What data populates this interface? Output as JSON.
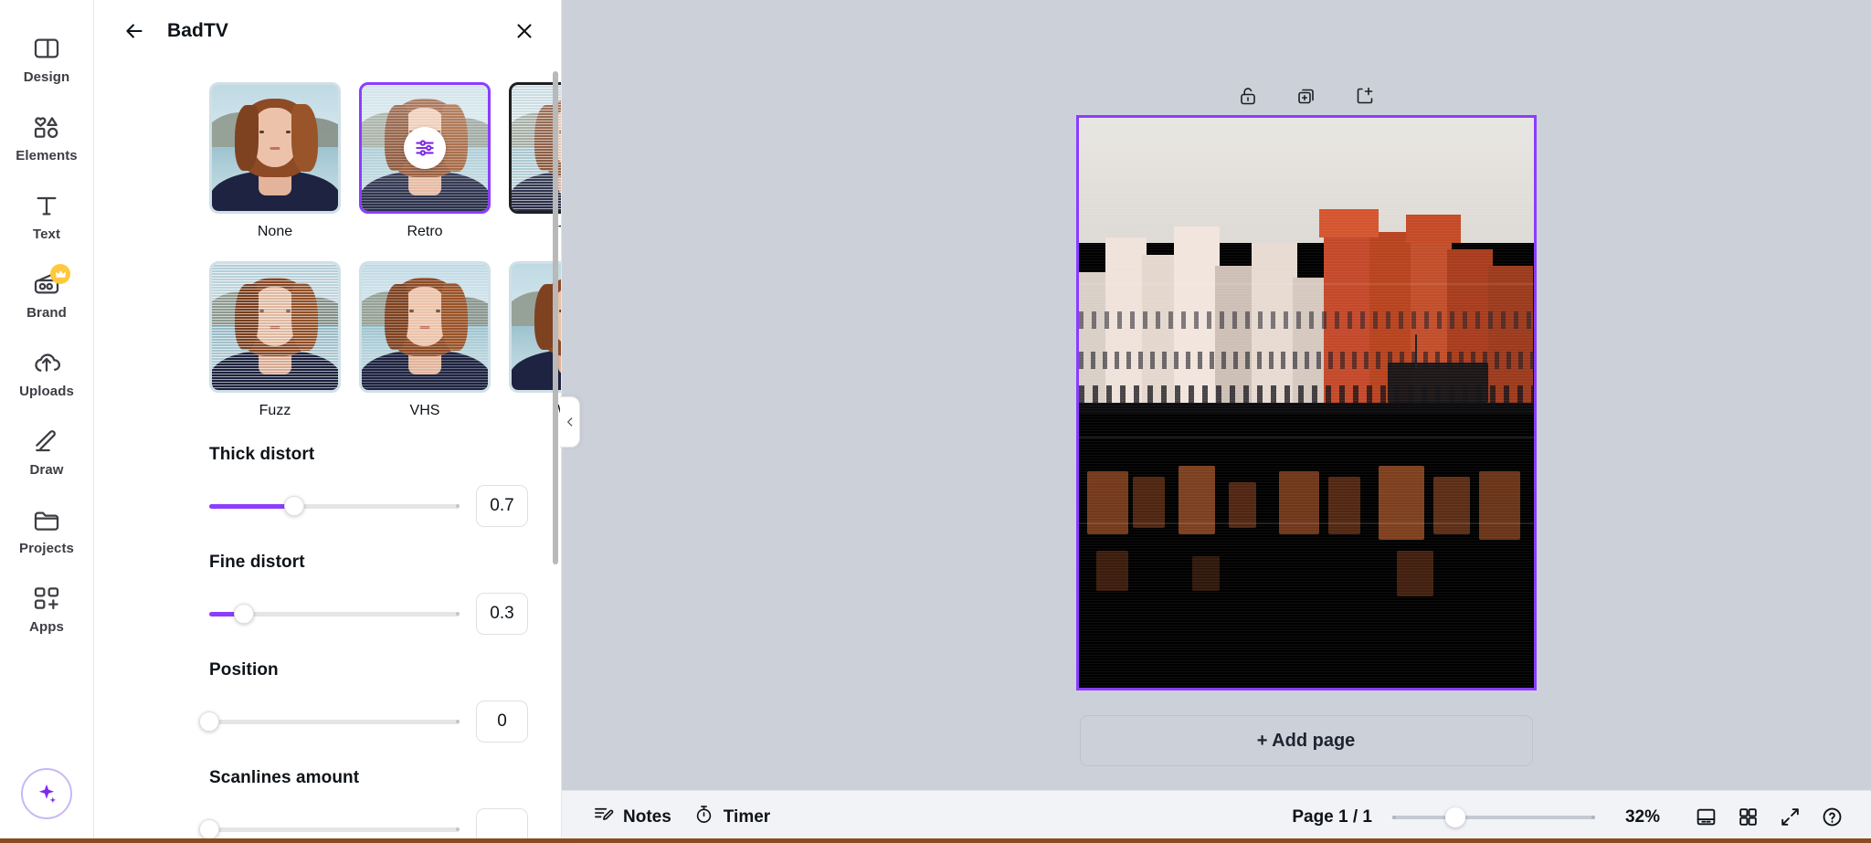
{
  "rail": {
    "items": [
      {
        "label": "Design",
        "icon": "design-icon",
        "badge": null
      },
      {
        "label": "Elements",
        "icon": "elements-icon",
        "badge": null
      },
      {
        "label": "Text",
        "icon": "text-icon",
        "badge": null
      },
      {
        "label": "Brand",
        "icon": "brand-icon",
        "badge": "crown-badge"
      },
      {
        "label": "Uploads",
        "icon": "uploads-icon",
        "badge": null
      },
      {
        "label": "Draw",
        "icon": "draw-icon",
        "badge": null
      },
      {
        "label": "Projects",
        "icon": "projects-icon",
        "badge": null
      },
      {
        "label": "Apps",
        "icon": "apps-icon",
        "badge": null
      }
    ],
    "ai_assistant": "magic-sparkle-icon"
  },
  "panel": {
    "back_icon": "back-arrow-icon",
    "title": "BadTV",
    "close_icon": "close-icon",
    "collapse_icon": "chevron-left-icon",
    "effects": [
      {
        "label": "None",
        "state": "normal",
        "style": "none"
      },
      {
        "label": "Retro",
        "state": "selected",
        "style": "retro",
        "badge_icon": "sliders-icon"
      },
      {
        "label": "Tube",
        "state": "hover",
        "style": "tube"
      },
      {
        "label": "Fuzz",
        "state": "normal",
        "style": "fuzz"
      },
      {
        "label": "VHS",
        "state": "normal",
        "style": "vhs"
      },
      {
        "label": "Warp",
        "state": "normal",
        "style": "warp"
      }
    ],
    "sliders": [
      {
        "label": "Thick distort",
        "value": "0.7",
        "percent": 34
      },
      {
        "label": "Fine distort",
        "value": "0.3",
        "percent": 14
      },
      {
        "label": "Position",
        "value": "0",
        "percent": 0
      },
      {
        "label": "Scanlines amount",
        "value": "",
        "percent": 0
      }
    ],
    "accent_color": "#8b3dff"
  },
  "canvas": {
    "object_toolbar": [
      {
        "name": "lock-icon",
        "title": "Lock"
      },
      {
        "name": "duplicate-icon",
        "title": "Duplicate"
      },
      {
        "name": "add-page-icon",
        "title": "Add page"
      }
    ],
    "add_page_label": "+ Add page",
    "selection_color": "#8b3dff"
  },
  "bottombar": {
    "notes_label": "Notes",
    "notes_icon": "notes-icon",
    "timer_label": "Timer",
    "timer_icon": "timer-icon",
    "page_indicator": "Page 1 / 1",
    "zoom_value": "32%",
    "zoom_percent": 31,
    "icons": [
      {
        "name": "presentation-icon"
      },
      {
        "name": "grid-view-icon"
      },
      {
        "name": "fullscreen-icon"
      },
      {
        "name": "help-icon"
      }
    ]
  }
}
